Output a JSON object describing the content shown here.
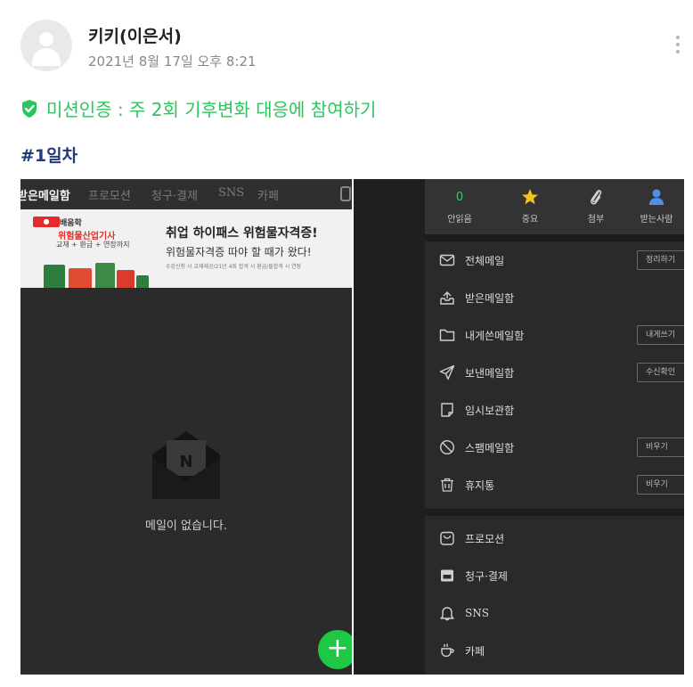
{
  "post": {
    "author": "키키(이은서)",
    "date": "2021년 8월 17일 오후 8:21",
    "mission": "미션인증 : 주 2회 기후변화 대응에 참여하기",
    "day_title": "#1일차"
  },
  "colors": {
    "accent_green": "#2cc55c",
    "day_title": "#223a7a",
    "fab": "#1ec845"
  },
  "left_screen": {
    "tabs": [
      "받은메일함",
      "프로모션",
      "청구·결제",
      "SNS",
      "카페"
    ],
    "ad": {
      "school": "배움학",
      "course": "위험물산업기사",
      "perks": "교재 + 환급 + 연장까지",
      "headline": "취업 하이패스 위험물자격증!",
      "subline": "위험물자격증 따야 할 때가 왔다!",
      "fine_print": "수강신청 시 교재제공/21년 4회 합격 시 환급/불합격 시 연장",
      "envelope_mark": "N"
    },
    "empty_message": "메일이 없습니다.",
    "fab_label": "+"
  },
  "right_screen": {
    "stats": [
      {
        "value": "0",
        "label": "안읽음",
        "icon": ""
      },
      {
        "value": "",
        "label": "중요",
        "icon": "star-icon"
      },
      {
        "value": "",
        "label": "첨부",
        "icon": "paperclip-icon"
      },
      {
        "value": "",
        "label": "받는사람",
        "icon": "person-icon"
      }
    ],
    "menu": [
      {
        "label": "전체메일",
        "icon": "envelope-icon",
        "button": "정리하기"
      },
      {
        "label": "받은메일함",
        "icon": "inbox-icon",
        "button": ""
      },
      {
        "label": "내게쓴메일함",
        "icon": "folder-icon",
        "button": "내게쓰기"
      },
      {
        "label": "보낸메일함",
        "icon": "send-icon",
        "button": "수신확인"
      },
      {
        "label": "임시보관함",
        "icon": "draft-icon",
        "button": ""
      },
      {
        "label": "스팸메일함",
        "icon": "block-icon",
        "button": "비우기"
      },
      {
        "label": "휴지통",
        "icon": "trash-icon",
        "button": "비우기"
      }
    ],
    "categories": [
      {
        "label": "프로모션",
        "icon": "bag-icon"
      },
      {
        "label": "청구·결제",
        "icon": "receipt-icon"
      },
      {
        "label": "SNS",
        "icon": "bell-icon"
      },
      {
        "label": "카페",
        "icon": "cup-icon"
      }
    ]
  }
}
